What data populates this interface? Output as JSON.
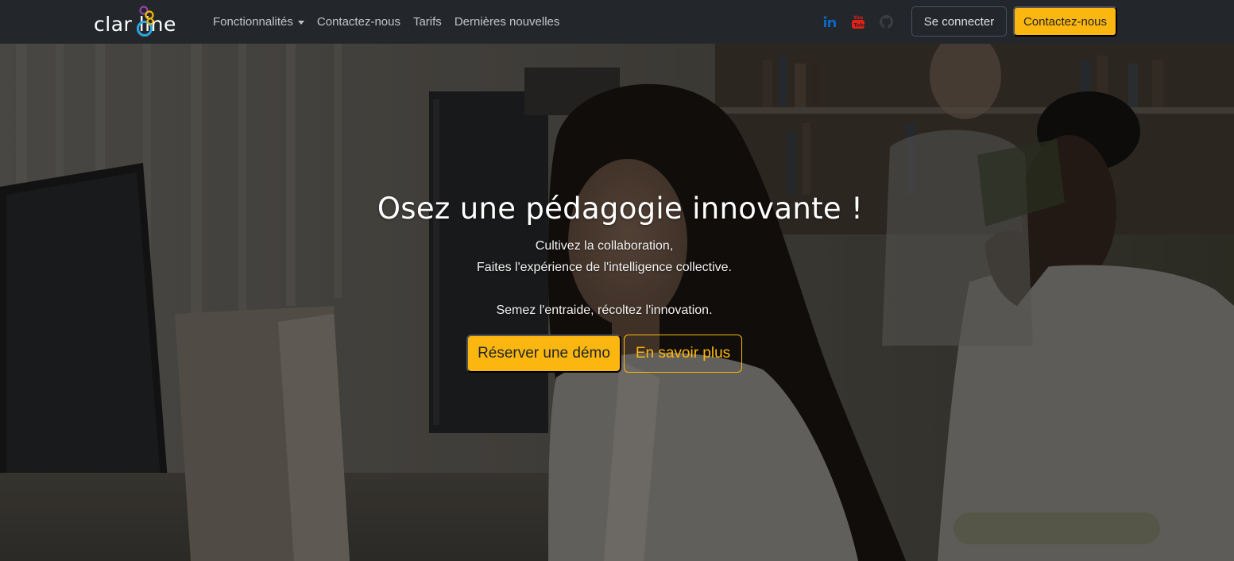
{
  "brand": {
    "logo_text": "clar   line"
  },
  "nav": {
    "items": [
      {
        "label": "Fonctionnalités",
        "has_dropdown": true
      },
      {
        "label": "Contactez-nous",
        "has_dropdown": false
      },
      {
        "label": "Tarifs",
        "has_dropdown": false
      },
      {
        "label": "Dernières nouvelles",
        "has_dropdown": false
      }
    ],
    "social_icons": [
      "linkedin-icon",
      "youtube-icon",
      "github-icon"
    ],
    "login_label": "Se connecter",
    "contact_label": "Contactez-nous"
  },
  "hero": {
    "title": "Osez une pédagogie innovante !",
    "line1": "Cultivez la collaboration,",
    "line2": "Faites l'expérience de l'intelligence collective.",
    "line3": "Semez l'entraide, récoltez l'innovation.",
    "primary_button": "Réserver une démo",
    "secondary_button": "En savoir plus"
  },
  "colors": {
    "accent": "#fbb70f",
    "navbar": "#23272b",
    "linkedin": "#0a66c2",
    "youtube": "#e62117"
  }
}
